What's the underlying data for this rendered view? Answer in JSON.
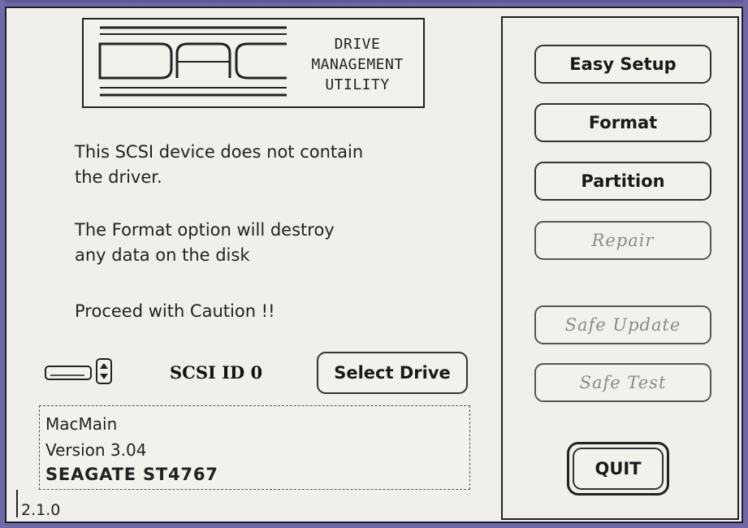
{
  "logo": {
    "letters": "DAC",
    "line1": "DRIVE",
    "line2": "MANAGEMENT",
    "line3": "UTILITY"
  },
  "messages": {
    "line1": "This SCSI device does not contain",
    "line2": "the driver.",
    "line3": "The Format option will destroy",
    "line4": "any data on the disk",
    "line5": "Proceed with Caution !!"
  },
  "drive": {
    "scsi_id": "SCSI ID 0",
    "select_label": "Select Drive"
  },
  "info": {
    "name": "MacMain",
    "version": "Version 3.04",
    "model": "SEAGATE ST4767"
  },
  "app_version": "2.1.0",
  "buttons": {
    "easy_setup": "Easy Setup",
    "format": "Format",
    "partition": "Partition",
    "repair": "Repair",
    "safe_update": "Safe Update",
    "safe_test": "Safe Test",
    "quit": "QUIT"
  },
  "colors": {
    "desktop": "#6f6aa6",
    "window": "#f1efe9",
    "text": "#222222",
    "disabled_text": "#8a8a8a"
  }
}
